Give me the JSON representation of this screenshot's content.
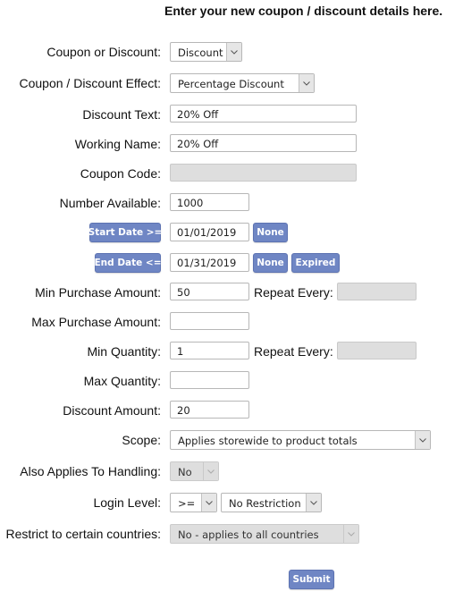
{
  "header": {
    "title": "Enter your new coupon / discount details here."
  },
  "form": {
    "coupon_or_discount": {
      "label": "Coupon or Discount:",
      "value": "Discount"
    },
    "effect": {
      "label": "Coupon / Discount Effect:",
      "value": "Percentage Discount"
    },
    "discount_text": {
      "label": "Discount Text:",
      "value": "20% Off"
    },
    "working_name": {
      "label": "Working Name:",
      "value": "20% Off"
    },
    "coupon_code": {
      "label": "Coupon Code:",
      "value": ""
    },
    "number_available": {
      "label": "Number Available:",
      "value": "1000"
    },
    "start_date": {
      "button": "Start Date >=",
      "value": "01/01/2019",
      "none_button": "None"
    },
    "end_date": {
      "button": "End Date <=",
      "value": "01/31/2019",
      "none_button": "None",
      "expired_button": "Expired"
    },
    "min_purchase": {
      "label": "Min Purchase Amount:",
      "value": "50",
      "repeat_label": "Repeat Every:",
      "repeat_value": ""
    },
    "max_purchase": {
      "label": "Max Purchase Amount:",
      "value": ""
    },
    "min_quantity": {
      "label": "Min Quantity:",
      "value": "1",
      "repeat_label": "Repeat Every:",
      "repeat_value": ""
    },
    "max_quantity": {
      "label": "Max Quantity:",
      "value": ""
    },
    "discount_amount": {
      "label": "Discount Amount:",
      "value": "20"
    },
    "scope": {
      "label": "Scope:",
      "value": "Applies storewide to product totals"
    },
    "handling": {
      "label": "Also Applies To Handling:",
      "value": "No"
    },
    "login_level": {
      "label": "Login Level:",
      "operator": ">=",
      "value": "No Restriction"
    },
    "countries": {
      "label": "Restrict to certain countries:",
      "value": "No - applies to all countries"
    },
    "submit": "Submit"
  }
}
